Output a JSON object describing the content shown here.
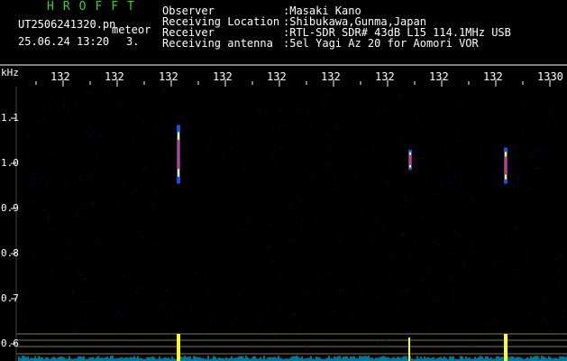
{
  "header": {
    "brand": "HROFFT",
    "filename": "UT2506241320.pn",
    "detection_label": "meteor",
    "datetime": "25.06.24 13:20",
    "counter": "3."
  },
  "info": [
    {
      "key": "Observer",
      "value": ":Masaki Kano"
    },
    {
      "key": "Receiving Location",
      "value": ":Shibukawa,Gunma,Japan"
    },
    {
      "key": "Receiver",
      "value": ":RTL-SDR SDR# 43dB L15 114.1MHz USB"
    },
    {
      "key": "Receiving antenna",
      "value": ":5el Yagi Az 20 for Aomori VOR"
    }
  ],
  "chart_data": {
    "type": "heatmap",
    "ylabel": "kHz",
    "ylim": [
      0.58,
      1.2
    ],
    "yticks": [
      "1.1",
      "1.0",
      "0.9",
      "0.8",
      "0.7",
      "0.6"
    ],
    "xticks": [
      "132",
      "132",
      "132",
      "132",
      "132",
      "132",
      "132",
      "132",
      "132",
      "1330"
    ],
    "echoes": [
      {
        "x": 1322.4,
        "f_low": 0.955,
        "f_high": 1.085
      },
      {
        "x": 1327.1,
        "f_low": 0.985,
        "f_high": 1.03
      },
      {
        "x": 1329.1,
        "f_low": 0.955,
        "f_high": 1.035
      }
    ],
    "colors": {
      "accent": "#39d339",
      "echo_core": "#ff3030",
      "echo_edge": "#2060ff",
      "echo_mid": "#ffff40",
      "noise": "#00c8ff"
    }
  }
}
